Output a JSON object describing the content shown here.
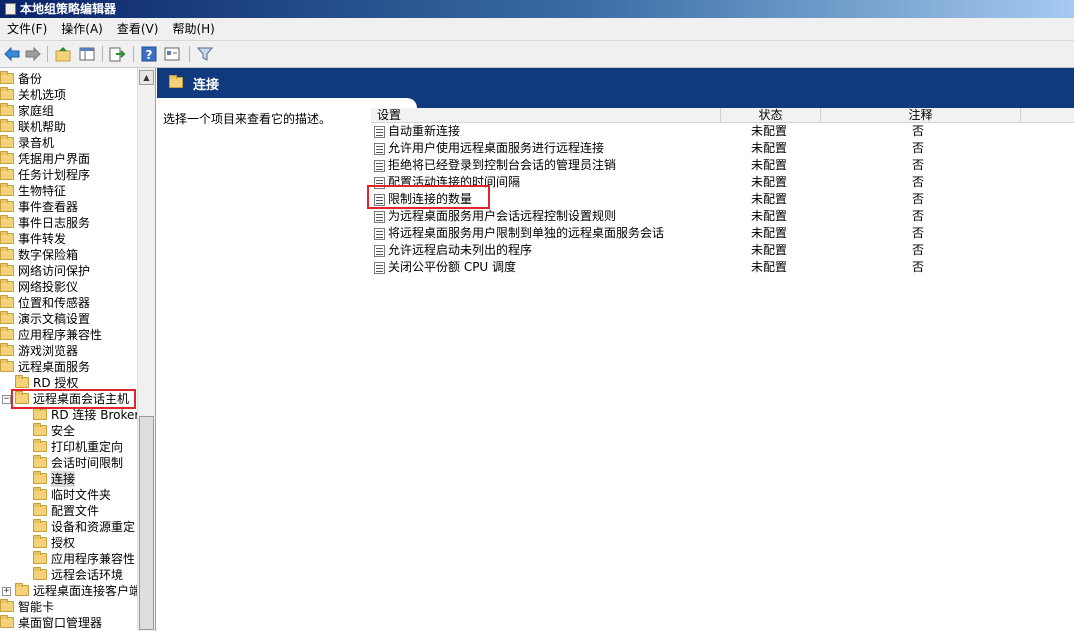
{
  "window": {
    "title": "本地组策略编辑器"
  },
  "menu": [
    "文件(F)",
    "操作(A)",
    "查看(V)",
    "帮助(H)"
  ],
  "toolbar_icons": [
    "back-icon",
    "forward-icon",
    "up-folder-icon",
    "show-hide-tree-icon",
    "export-list-icon",
    "help-icon",
    "properties-icon",
    "filter-icon"
  ],
  "tree": [
    {
      "label": "备份"
    },
    {
      "label": "关机选项"
    },
    {
      "label": "家庭组"
    },
    {
      "label": "联机帮助"
    },
    {
      "label": "录音机"
    },
    {
      "label": "凭据用户界面"
    },
    {
      "label": "任务计划程序"
    },
    {
      "label": "生物特征"
    },
    {
      "label": "事件查看器"
    },
    {
      "label": "事件日志服务"
    },
    {
      "label": "事件转发"
    },
    {
      "label": "数字保险箱"
    },
    {
      "label": "网络访问保护"
    },
    {
      "label": "网络投影仪"
    },
    {
      "label": "位置和传感器"
    },
    {
      "label": "演示文稿设置"
    },
    {
      "label": "应用程序兼容性"
    },
    {
      "label": "游戏浏览器"
    },
    {
      "label": "远程桌面服务"
    },
    {
      "label": "RD 授权"
    },
    {
      "label": "远程桌面会话主机",
      "expander": "⊟"
    },
    {
      "label": "RD 连接 Broker"
    },
    {
      "label": "安全"
    },
    {
      "label": "打印机重定向"
    },
    {
      "label": "会话时间限制"
    },
    {
      "label": "连接"
    },
    {
      "label": "临时文件夹"
    },
    {
      "label": "配置文件"
    },
    {
      "label": "设备和资源重定"
    },
    {
      "label": "授权"
    },
    {
      "label": "应用程序兼容性"
    },
    {
      "label": "远程会话环境"
    },
    {
      "label": "远程桌面连接客户端",
      "expander": "⊞"
    },
    {
      "label": "智能卡"
    },
    {
      "label": "桌面窗口管理器"
    }
  ],
  "details": {
    "header_title": "连接",
    "description": "选择一个项目来查看它的描述。",
    "columns": [
      "设置",
      "状态",
      "注释"
    ],
    "rows": [
      {
        "name": "自动重新连接",
        "state": "未配置",
        "note": "否"
      },
      {
        "name": "允许用户使用远程桌面服务进行远程连接",
        "state": "未配置",
        "note": "否"
      },
      {
        "name": "拒绝将已经登录到控制台会话的管理员注销",
        "state": "未配置",
        "note": "否"
      },
      {
        "name": "配置活动连接的时间间隔",
        "state": "未配置",
        "note": "否"
      },
      {
        "name": "限制连接的数量",
        "state": "未配置",
        "note": "否"
      },
      {
        "name": "为远程桌面服务用户会话远程控制设置规则",
        "state": "未配置",
        "note": "否"
      },
      {
        "name": "将远程桌面服务用户限制到单独的远程桌面服务会话",
        "state": "未配置",
        "note": "否"
      },
      {
        "name": "允许远程启动未列出的程序",
        "state": "未配置",
        "note": "否"
      },
      {
        "name": "关闭公平份额 CPU 调度",
        "state": "未配置",
        "note": "否"
      }
    ]
  },
  "colors": {
    "header_band": "#11397e",
    "highlight_box": "#e0262b",
    "folder": "#f3d27a"
  }
}
